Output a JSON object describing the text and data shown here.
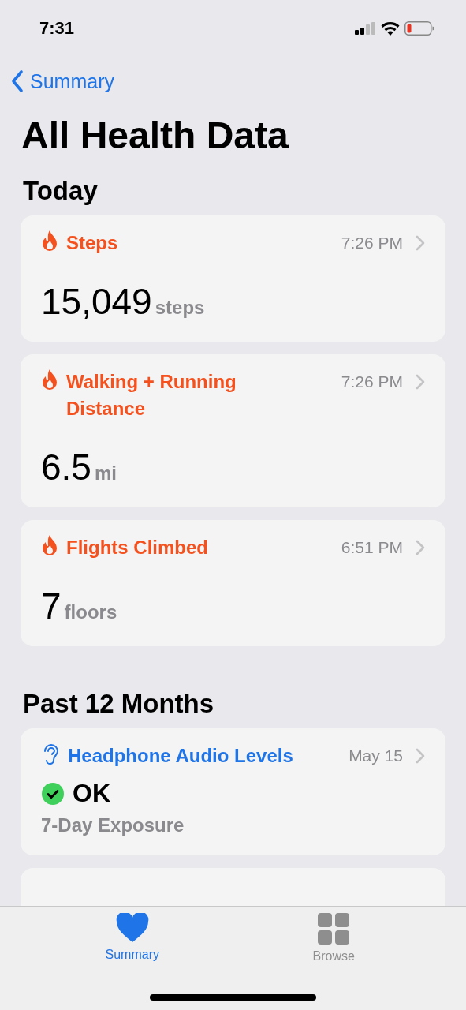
{
  "status_bar": {
    "time": "7:31"
  },
  "nav": {
    "back": "Summary"
  },
  "title": "All Health Data",
  "sections": [
    {
      "heading": "Today",
      "cards": [
        {
          "kind": "metric",
          "color": "#f4511e",
          "title": "Steps",
          "time": "7:26 PM",
          "value": "15,049",
          "unit": "steps"
        },
        {
          "kind": "metric",
          "color": "#f4511e",
          "title": "Walking + Running Distance",
          "time": "7:26 PM",
          "value": "6.5",
          "unit": "mi"
        },
        {
          "kind": "metric",
          "color": "#f4511e",
          "title": "Flights Climbed",
          "time": "6:51 PM",
          "value": "7",
          "unit": "floors"
        }
      ]
    },
    {
      "heading": "Past 12 Months",
      "cards": [
        {
          "kind": "status",
          "color": "#1f75e8",
          "title": "Headphone Audio Levels",
          "time": "May 15",
          "value": "OK",
          "unit": "7-Day Exposure"
        },
        {
          "kind": "picture"
        }
      ]
    }
  ],
  "tabs": [
    {
      "label": "Summary",
      "selected": true
    },
    {
      "label": "Browse",
      "selected": false
    }
  ]
}
